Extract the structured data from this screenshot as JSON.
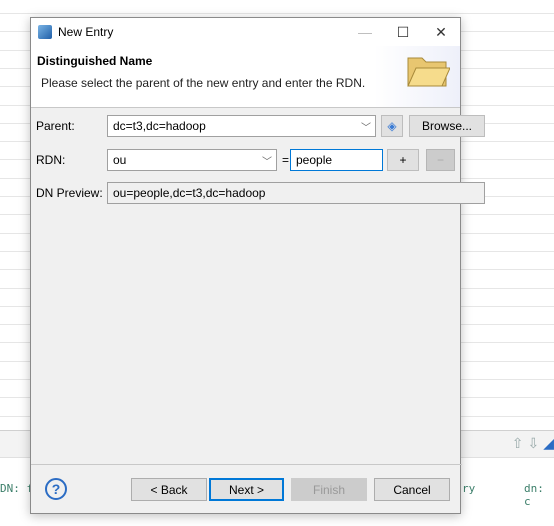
{
  "background": {
    "left_text": "DN: fa",
    "right_text_1": "ry",
    "right_text_2": "dn: c"
  },
  "dialog": {
    "title": "New Entry",
    "header": {
      "title": "Distinguished Name",
      "description": "Please select the parent of the new entry and enter the RDN."
    },
    "parent": {
      "label": "Parent:",
      "value": "dc=t3,dc=hadoop",
      "browse_label": "Browse..."
    },
    "rdn": {
      "label": "RDN:",
      "type_value": "ou",
      "equals": "=",
      "value": "people",
      "add_label": "+",
      "remove_label": "−"
    },
    "dn_preview": {
      "label": "DN Preview:",
      "value": "ou=people,dc=t3,dc=hadoop"
    },
    "buttons": {
      "back": "< Back",
      "next": "Next >",
      "finish": "Finish",
      "cancel": "Cancel",
      "help": "?"
    },
    "accent": "#0078d7"
  }
}
